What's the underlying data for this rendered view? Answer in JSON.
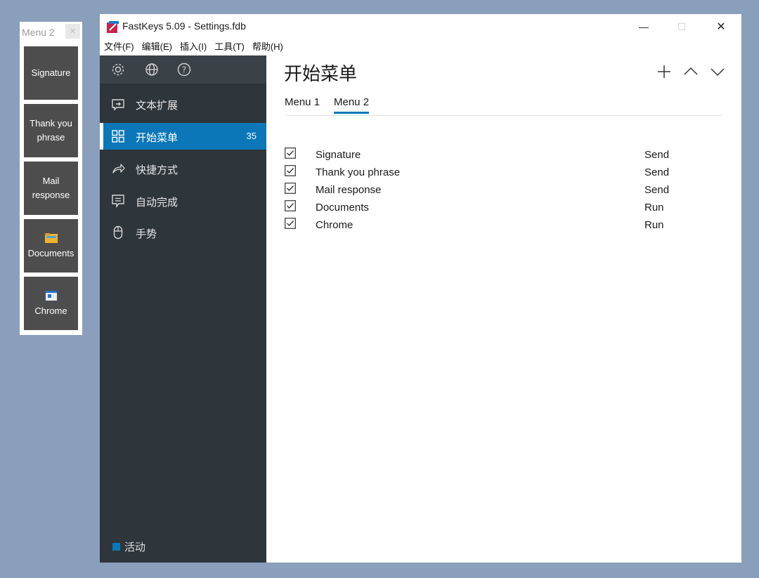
{
  "float_menu": {
    "title": "Menu 2",
    "close_icon": "close-icon",
    "tiles": [
      {
        "label": "Signature",
        "icon": ""
      },
      {
        "label": "Thank you phrase",
        "icon": ""
      },
      {
        "label": "Mail response",
        "icon": ""
      },
      {
        "label": "Documents",
        "icon": "folder-icon"
      },
      {
        "label": "Chrome",
        "icon": "app-window-icon"
      }
    ]
  },
  "window": {
    "title": "FastKeys 5.09  - Settings.fdb",
    "controls": {
      "minimize": "—",
      "maximize": "☐",
      "close": "✕"
    },
    "menubar": [
      "文件(F)",
      "编辑(E)",
      "插入(I)",
      "工具(T)",
      "帮助(H)"
    ]
  },
  "sidebar": {
    "tools": [
      "gear-icon",
      "globe-icon",
      "help-icon"
    ],
    "items": [
      {
        "label": "文本扩展",
        "icon": "text-expand-icon",
        "count": ""
      },
      {
        "label": "开始菜单",
        "icon": "grid-icon",
        "count": "35",
        "active": true
      },
      {
        "label": "快捷方式",
        "icon": "shortcut-arrow-icon",
        "count": ""
      },
      {
        "label": "自动完成",
        "icon": "autocomplete-icon",
        "count": ""
      },
      {
        "label": "手势",
        "icon": "mouse-icon",
        "count": ""
      }
    ],
    "status": "活动"
  },
  "content": {
    "title": "开始菜单",
    "header_buttons": [
      "plus-icon",
      "chevron-up-icon",
      "chevron-down-icon"
    ],
    "tabs": [
      {
        "label": "Menu 1",
        "active": false
      },
      {
        "label": "Menu 2",
        "active": true
      }
    ],
    "rows": [
      {
        "name": "Signature",
        "action": "Send",
        "checked": true
      },
      {
        "name": "Thank you phrase",
        "action": "Send",
        "checked": true
      },
      {
        "name": "Mail response",
        "action": "Send",
        "checked": true
      },
      {
        "name": "Documents",
        "action": "Run",
        "checked": true
      },
      {
        "name": "Chrome",
        "action": "Run",
        "checked": true
      }
    ]
  },
  "colors": {
    "accent": "#0b77b8",
    "sidebar": "#2e353b",
    "tile": "#4d4d4d",
    "desktop": "#8a9fbb"
  }
}
